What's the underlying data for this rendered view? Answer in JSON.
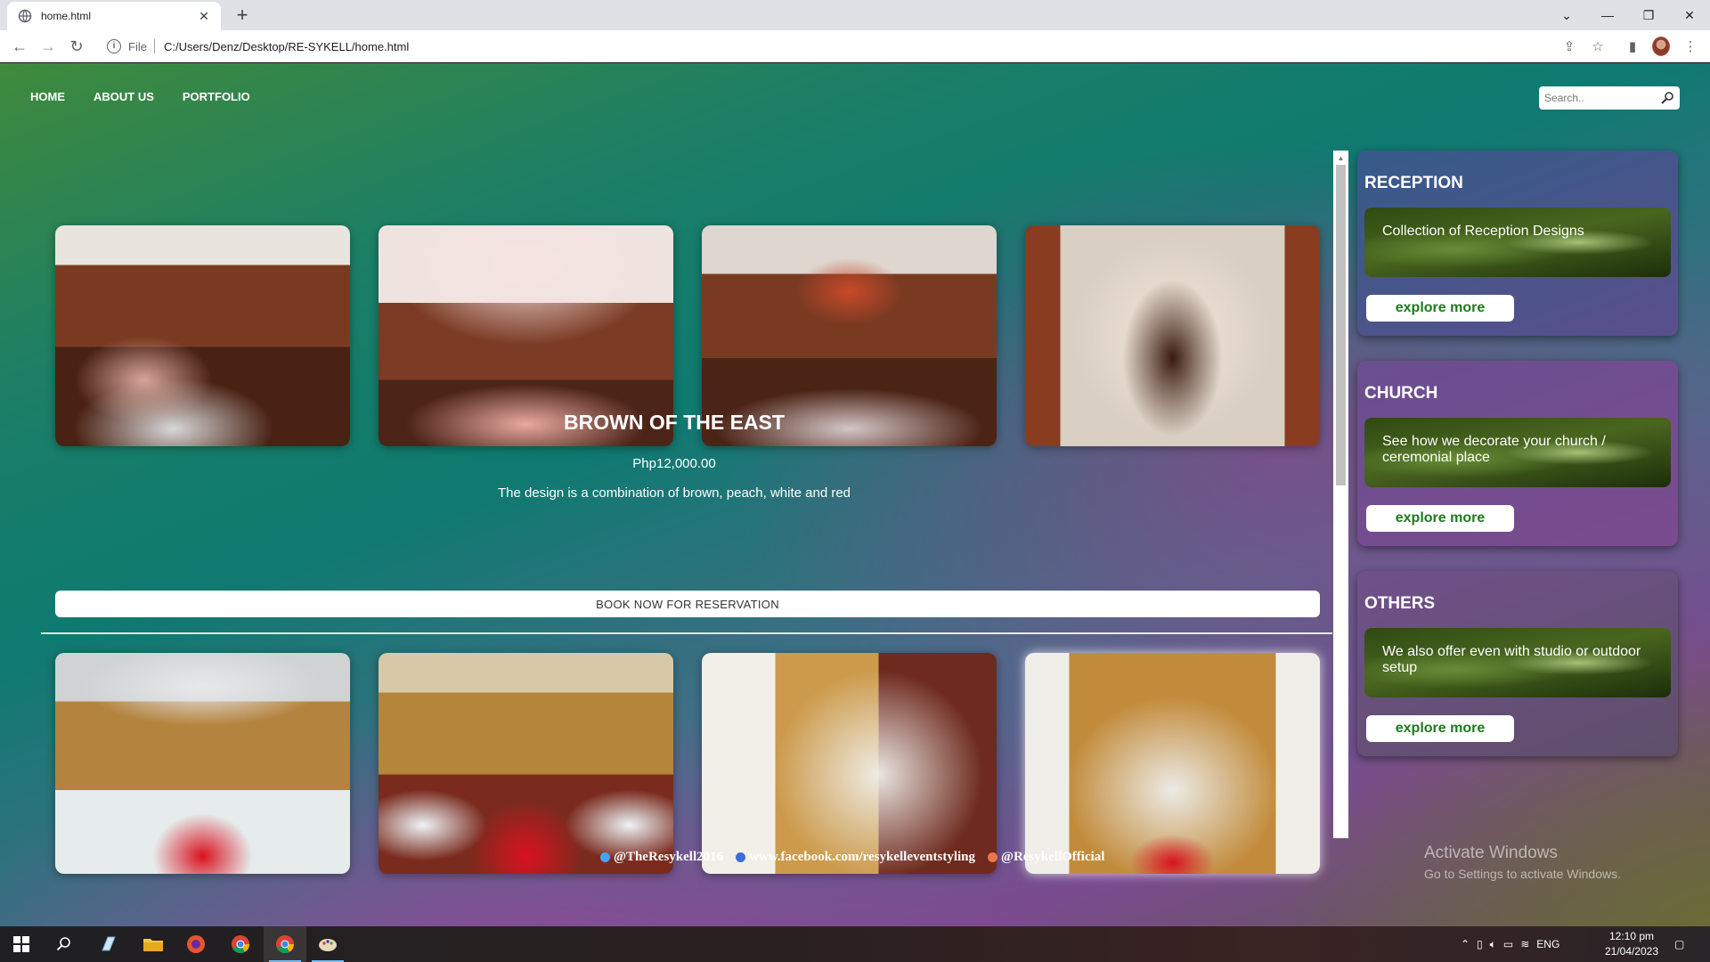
{
  "browser": {
    "tab_title": "home.html",
    "url_scheme": "File",
    "url": "C:/Users/Denz/Desktop/RE-SYKELL/home.html"
  },
  "nav": {
    "items": [
      "HOME",
      "ABOUT US",
      "PORTFOLIO"
    ]
  },
  "search": {
    "placeholder": "Search.."
  },
  "product": {
    "name": "BROWN OF THE EAST",
    "price": "Php12,000.00",
    "description": "The design is a combination of brown, peach, white and red",
    "book_label": "BOOK NOW FOR RESERVATION"
  },
  "sidebar": [
    {
      "title": "RECEPTION",
      "text": "Collection of Reception Designs",
      "button": "explore more"
    },
    {
      "title": "CHURCH",
      "text": "See how we decorate your church / ceremonial place",
      "button": "explore more"
    },
    {
      "title": "OTHERS",
      "text": "We also offer even with studio or outdoor setup",
      "button": "explore more"
    }
  ],
  "social": {
    "twitter": "@TheResykell2016",
    "facebook": "www.facebook.com/resykelleventstyling",
    "instagram": "@ResykellOfficial"
  },
  "watermark": {
    "line1": "Activate Windows",
    "line2": "Go to Settings to activate Windows."
  },
  "taskbar": {
    "lang": "ENG",
    "time": "12:10 pm",
    "date": "21/04/2023"
  },
  "colors": {
    "accent_green": "#1f7a1f",
    "taskbar_indicator": "#76b9ed"
  }
}
